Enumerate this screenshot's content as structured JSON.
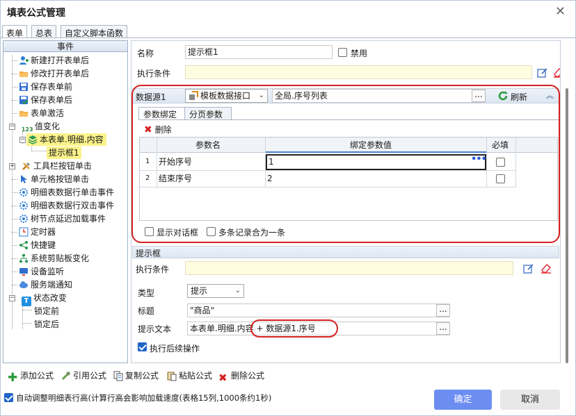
{
  "dialog": {
    "title": "填表公式管理"
  },
  "top_tabs": [
    "表单",
    "总表",
    "自定义脚本函数"
  ],
  "tree": {
    "header": "事件",
    "items": [
      "新建打开表单后",
      "修改打开表单后",
      "保存表单前",
      "保存表单后",
      "表单激活",
      "值变化",
      "本表单.明细.内容",
      "提示框1",
      "工具栏按钮单击",
      "单元格按钮单击",
      "明细表数据行单击事件",
      "明细表数据行双击事件",
      "树节点延迟加载事件",
      "定时器",
      "快捷键",
      "系统剪贴板变化",
      "设备监听",
      "服务端通知",
      "状态改变",
      "锁定前",
      "锁定后"
    ]
  },
  "form": {
    "name_label": "名称",
    "name_value": "提示框1",
    "disable_label": "禁用",
    "condition_label": "执行条件",
    "condition_value": ""
  },
  "datasource": {
    "label": "数据源1",
    "type_value": "模板数据接口",
    "path_value": "全局.序号列表",
    "dots": "...",
    "refresh_label": "刷新",
    "tabs": [
      "参数绑定",
      "分页参数"
    ],
    "delete_label": "删除",
    "table": {
      "headers": [
        "参数名",
        "绑定参数值",
        "必填"
      ],
      "rows": [
        {
          "index": "1",
          "name": "开始序号",
          "value": "1",
          "required": false
        },
        {
          "index": "2",
          "name": "结束序号",
          "value": "2",
          "required": false
        }
      ]
    },
    "show_dialog_label": "显示对话框",
    "merge_label": "多条记录合为一条"
  },
  "prompt": {
    "section_title": "提示框",
    "condition_label": "执行条件",
    "type_label": "类型",
    "type_value": "提示",
    "title_label": "标题",
    "title_value": "\"商品\"",
    "text_label": "提示文本",
    "text_value": "本表单.明细.内容 + 数据源1.序号",
    "continue_label": "执行后续操作"
  },
  "bottom": {
    "add": "添加公式",
    "ref": "引用公式",
    "copy": "复制公式",
    "paste": "粘贴公式",
    "delete": "删除公式",
    "auto_row_label": "自动调整明细表行高(计算行高会影响加载速度(表格15列,1000条约1秒)",
    "ok": "确定",
    "cancel": "取消"
  }
}
